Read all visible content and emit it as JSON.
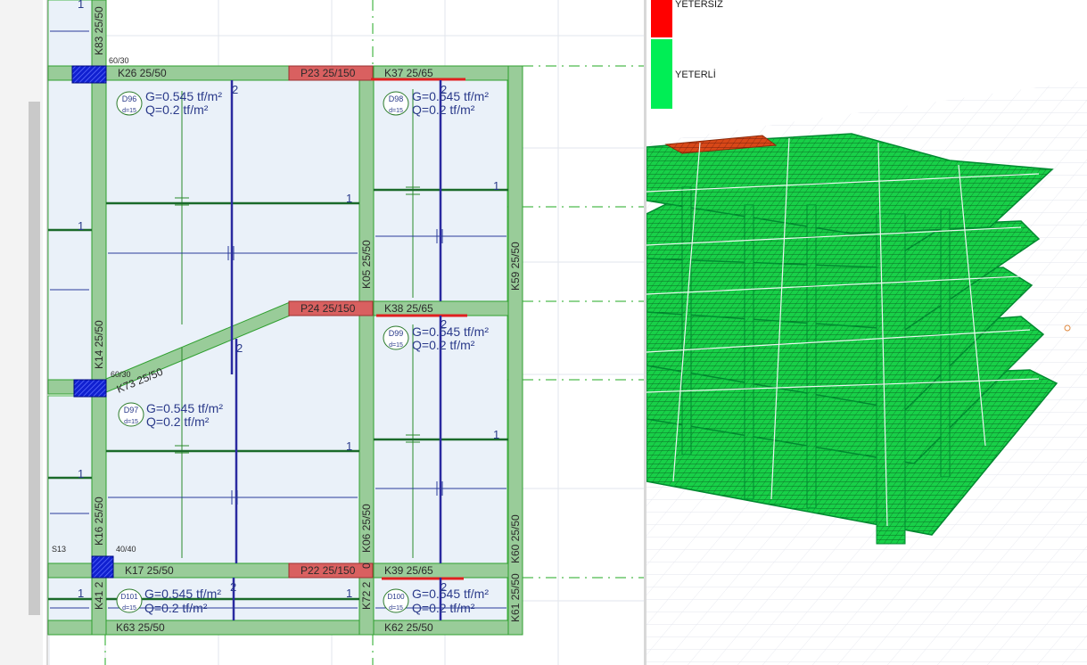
{
  "legend": {
    "items": [
      {
        "label": "YETERSİZ",
        "color": "#ff0000"
      },
      {
        "label": "YETERLİ",
        "color": "#00ee55"
      }
    ]
  },
  "plan": {
    "column_sizes": {
      "c_top": "60/30",
      "c_mid": "60/30",
      "c_bot": "40/40"
    },
    "axis_label": "S13",
    "beams": {
      "K26": "K26 25/50",
      "K37": "K37 25/65",
      "P23": "P23 25/150",
      "K38": "K38 25/65",
      "P24": "P24 25/150",
      "K17": "K17 25/50",
      "P22": "P22 25/150",
      "K39": "K39 25/65",
      "K63": "K63 25/50",
      "K62": "K62 25/50",
      "K83": "K83 25/50",
      "K14": "K14 25/50",
      "K16": "K16 25/50",
      "K41": "K41 2",
      "K05": "K05 25/50",
      "K06": "K06 25/50",
      "K72": "K72 2",
      "K59": "K59 25/50",
      "K60": "K60 25/50",
      "K61": "K61 25/50",
      "K73": "K73 25/50",
      "left_cut": "0"
    },
    "slabs": [
      {
        "id": "D96",
        "thk": "d=15",
        "g": "G=0.545 tf/m²",
        "q": "Q=0.2 tf/m²"
      },
      {
        "id": "D98",
        "thk": "d=15",
        "g": "G=0.545 tf/m²",
        "q": "Q=0.2 tf/m²"
      },
      {
        "id": "D97",
        "thk": "d=15",
        "g": "G=0.545 tf/m²",
        "q": "Q=0.2 tf/m²"
      },
      {
        "id": "D99",
        "thk": "d=15",
        "g": "G=0.545 tf/m²",
        "q": "Q=0.2 tf/m²"
      },
      {
        "id": "D101",
        "thk": "d=15",
        "g": "G=0.545 tf/m²",
        "q": "Q=0.2 tf/m²"
      },
      {
        "id": "D100",
        "thk": "d=15",
        "g": "G=0.545 tf/m²",
        "q": "Q=0.2 tf/m²"
      }
    ],
    "strip_labels": {
      "one": "1",
      "two": "2"
    }
  }
}
